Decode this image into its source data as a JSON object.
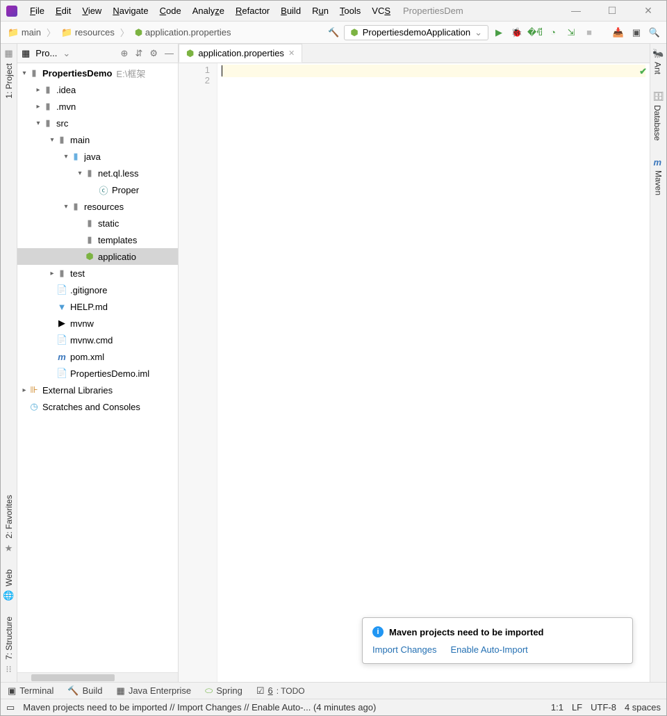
{
  "window": {
    "title": "PropertiesDem"
  },
  "menu": [
    "File",
    "Edit",
    "View",
    "Navigate",
    "Code",
    "Analyze",
    "Refactor",
    "Build",
    "Run",
    "Tools",
    "VCS"
  ],
  "breadcrumbs": [
    "main",
    "resources",
    "application.properties"
  ],
  "runConfig": {
    "name": "PropertiesdemoApplication"
  },
  "projectPanel": {
    "title": "Pro..."
  },
  "tree": {
    "root": {
      "name": "PropertiesDemo",
      "path": "E:\\框架"
    },
    "idea": ".idea",
    "mvn": ".mvn",
    "src": "src",
    "main": "main",
    "java": "java",
    "pkg": "net.ql.less",
    "appClass": "Proper",
    "resources": "resources",
    "static": "static",
    "templates": "templates",
    "appprops": "applicatio",
    "test": "test",
    "gitignore": ".gitignore",
    "help": "HELP.md",
    "mvnw": "mvnw",
    "mvnwcmd": "mvnw.cmd",
    "pom": "pom.xml",
    "iml": "PropertiesDemo.iml",
    "extlib": "External Libraries",
    "scratches": "Scratches and Consoles"
  },
  "tab": {
    "name": "application.properties"
  },
  "gutter": {
    "l1": "1",
    "l2": "2"
  },
  "popup": {
    "title": "Maven projects need to be imported",
    "link1": "Import Changes",
    "link2": "Enable Auto-Import"
  },
  "leftTabs": {
    "project": "1: Project",
    "favorites": "2: Favorites",
    "web": "Web",
    "structure": "7: Structure"
  },
  "rightTabs": {
    "ant": "Ant",
    "database": "Database",
    "maven": "Maven"
  },
  "bottomTabs": {
    "terminal": "Terminal",
    "build": "Build",
    "javaee": "Java Enterprise",
    "spring": "Spring",
    "todo": "6: TODO"
  },
  "status": {
    "msg": "Maven projects need to be imported // Import Changes // Enable Auto-... (4 minutes ago)",
    "pos": "1:1",
    "le": "LF",
    "enc": "UTF-8",
    "indent": "4 spaces"
  }
}
